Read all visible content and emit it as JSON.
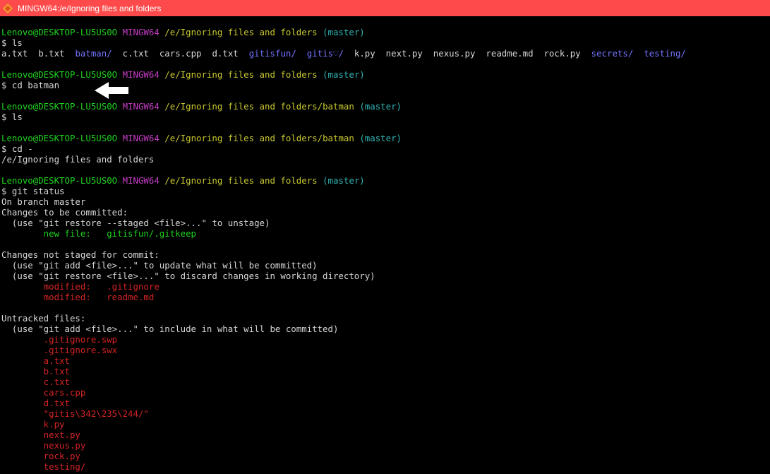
{
  "window": {
    "title": "MINGW64:/e/Ignoring files and folders"
  },
  "colors": {
    "titlebar": "#fe4a4a",
    "user": "#1fd41f",
    "env": "#c43cc4",
    "path": "#c8c82e",
    "branch": "#2fb4b4",
    "dir": "#7474ff",
    "error": "#d42424"
  },
  "prompt": {
    "user": "Lenovo@DESKTOP-LU5US0O",
    "env": "MINGW64",
    "root_path": "/e/Ignoring files and folders",
    "batman_path": "/e/Ignoring files and folders/batman",
    "branch": "(master)"
  },
  "commands": {
    "ls": "$ ls",
    "cd_batman": "$ cd batman",
    "ls2": "$ ls",
    "cd_back": "$ cd -",
    "git_status": "$ git status"
  },
  "ls_items": [
    {
      "text": "a.txt",
      "dir": false
    },
    {
      "text": "b.txt",
      "dir": false
    },
    {
      "text": "batman/",
      "dir": true
    },
    {
      "text": "c.txt",
      "dir": false
    },
    {
      "text": "cars.cpp",
      "dir": false
    },
    {
      "text": "d.txt",
      "dir": false
    },
    {
      "text": "gitisfun/",
      "dir": true
    },
    {
      "text": "gitis♡/",
      "dir": true
    },
    {
      "text": "k.py",
      "dir": false
    },
    {
      "text": "next.py",
      "dir": false
    },
    {
      "text": "nexus.py",
      "dir": false
    },
    {
      "text": "readme.md",
      "dir": false
    },
    {
      "text": "rock.py",
      "dir": false
    },
    {
      "text": "secrets/",
      "dir": true
    },
    {
      "text": "testing/",
      "dir": true
    }
  ],
  "cd_output": "/e/Ignoring files and folders",
  "status": {
    "branch_line": "On branch master",
    "staged_header": "Changes to be committed:",
    "staged_hint": "  (use \"git restore --staged <file>...\" to unstage)",
    "new_file": "        new file:   gitisfun/.gitkeep",
    "unstaged_header": "Changes not staged for commit:",
    "unstaged_hint1": "  (use \"git add <file>...\" to update what will be committed)",
    "unstaged_hint2": "  (use \"git restore <file>...\" to discard changes in working directory)",
    "modified": [
      "        modified:   .gitignore",
      "        modified:   readme.md"
    ],
    "untracked_header": "Untracked files:",
    "untracked_hint": "  (use \"git add <file>...\" to include in what will be committed)",
    "untracked": [
      "        .gitignore.swp",
      "        .gitignore.swx",
      "        a.txt",
      "        b.txt",
      "        c.txt",
      "        cars.cpp",
      "        d.txt",
      "        \"gitis\\342\\235\\244/\"",
      "        k.py",
      "        next.py",
      "        nexus.py",
      "        rock.py",
      "        testing/"
    ]
  }
}
